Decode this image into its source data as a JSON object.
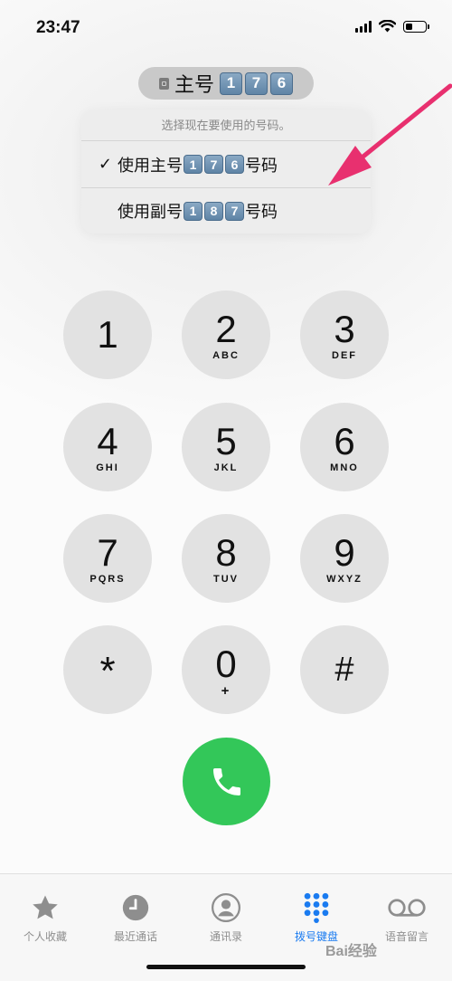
{
  "status_bar": {
    "time": "23:47",
    "battery_level": 0.3
  },
  "line_selector": {
    "label": "主号",
    "digits": [
      "1",
      "7",
      "6"
    ]
  },
  "line_menu": {
    "header": "选择现在要使用的号码。",
    "items": [
      {
        "checked": "✓",
        "prefix": "使用主号",
        "digits": [
          "1",
          "7",
          "6"
        ],
        "suffix": "号码"
      },
      {
        "checked": "",
        "prefix": "使用副号",
        "digits": [
          "1",
          "8",
          "7"
        ],
        "suffix": "号码"
      }
    ]
  },
  "keypad": [
    {
      "digit": "1",
      "letters": ""
    },
    {
      "digit": "2",
      "letters": "ABC"
    },
    {
      "digit": "3",
      "letters": "DEF"
    },
    {
      "digit": "4",
      "letters": "GHI"
    },
    {
      "digit": "5",
      "letters": "JKL"
    },
    {
      "digit": "6",
      "letters": "MNO"
    },
    {
      "digit": "7",
      "letters": "PQRS"
    },
    {
      "digit": "8",
      "letters": "TUV"
    },
    {
      "digit": "9",
      "letters": "WXYZ"
    },
    {
      "digit": "*",
      "letters": ""
    },
    {
      "digit": "0",
      "letters": "+"
    },
    {
      "digit": "#",
      "letters": ""
    }
  ],
  "tab_bar": {
    "items": [
      {
        "label": "个人收藏",
        "icon": "star-icon"
      },
      {
        "label": "最近通话",
        "icon": "clock-icon"
      },
      {
        "label": "通讯录",
        "icon": "person-icon"
      },
      {
        "label": "拨号键盘",
        "icon": "keypad-icon",
        "active": true
      },
      {
        "label": "语音留言",
        "icon": "voicemail-icon"
      }
    ]
  },
  "watermark": "Bai经验",
  "colors": {
    "accent": "#1a7bf0",
    "call": "#33c759",
    "arrow": "#e8306f",
    "key": "#e2e2e2"
  }
}
